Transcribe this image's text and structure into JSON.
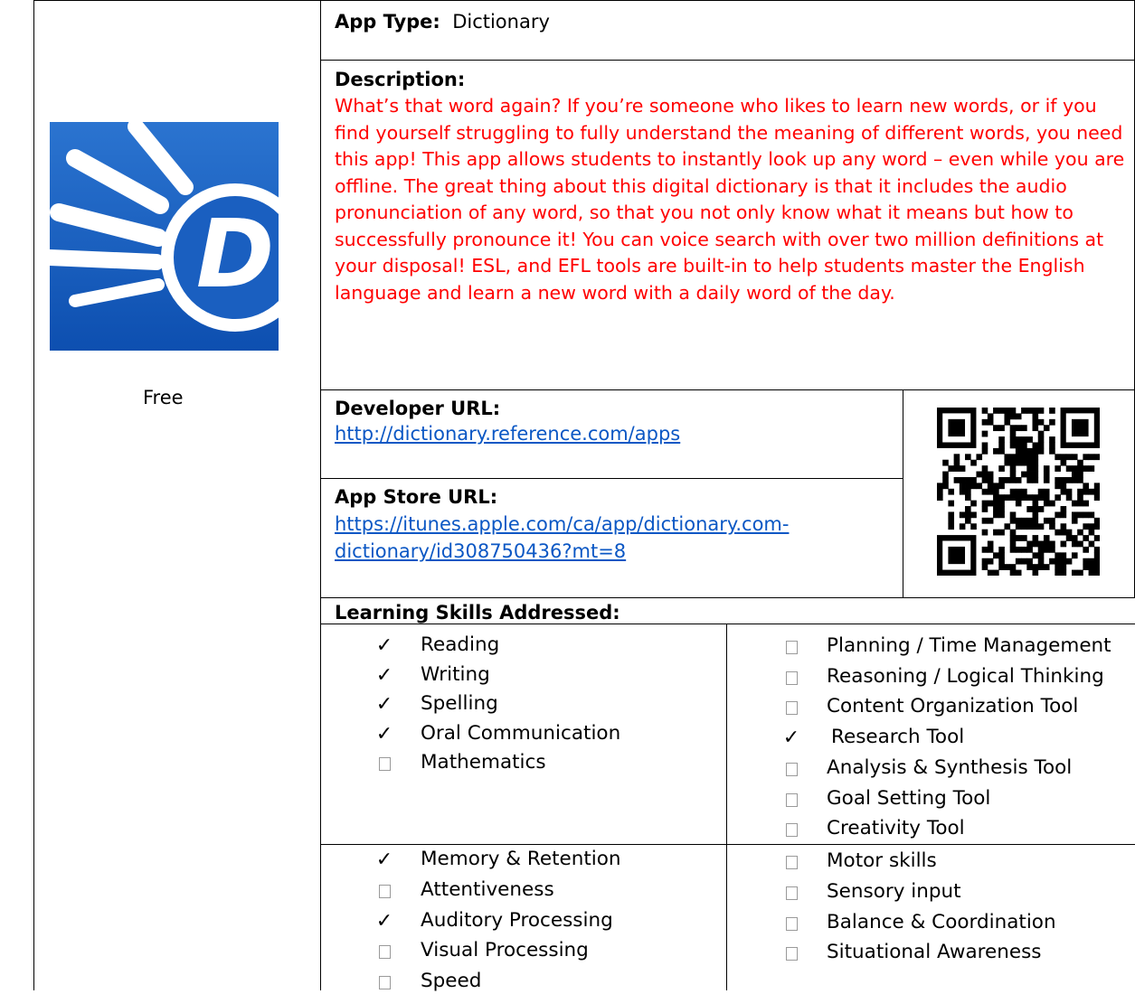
{
  "left": {
    "price": "Free"
  },
  "app_type": {
    "label": "App Type:",
    "value": "Dictionary"
  },
  "description": {
    "label": "Description:",
    "text": "What’s that word again? If you’re someone who likes to learn new words, or if you find yourself struggling to fully understand the meaning of different words, you need this app! This app allows students to instantly look up any word – even while you are offline. The great thing about this digital dictionary is that it includes the audio pronunciation of any word, so that you not only know what it means but how to successfully pronounce it! You can voice search with over two million definitions at your disposal! ESL, and EFL tools are built-in to help students master the English language and learn a new word with a daily word of the day."
  },
  "developer": {
    "label": "Developer URL:",
    "url": "http://dictionary.reference.com/apps"
  },
  "app_store": {
    "label": "App Store URL:",
    "url_line1": "https://itunes.apple.com/ca/app/dictionary.com-",
    "url_line2": "dictionary/id308750436?mt=8"
  },
  "skills": {
    "label": "Learning Skills Addressed:",
    "col1": [
      {
        "label": "Reading",
        "checked": true
      },
      {
        "label": "Writing",
        "checked": true
      },
      {
        "label": "Spelling",
        "checked": true
      },
      {
        "label": "Oral Communication",
        "checked": true
      },
      {
        "label": "Mathematics",
        "checked": false
      }
    ],
    "col2": [
      {
        "label": "Planning / Time Management",
        "checked": false
      },
      {
        "label": "Reasoning / Logical Thinking",
        "checked": false
      },
      {
        "label": "Content Organization Tool",
        "checked": false
      },
      {
        "label": "Research Tool",
        "checked": true
      },
      {
        "label": "Analysis & Synthesis Tool",
        "checked": false
      },
      {
        "label": "Goal Setting Tool",
        "checked": false
      },
      {
        "label": "Creativity Tool",
        "checked": false
      }
    ],
    "col3": [
      {
        "label": "Memory & Retention",
        "checked": true
      },
      {
        "label": "Attentiveness",
        "checked": false
      },
      {
        "label": "Auditory Processing",
        "checked": true
      },
      {
        "label": "Visual Processing",
        "checked": false
      },
      {
        "label": "Speed",
        "checked": false
      }
    ],
    "col4": [
      {
        "label": "Motor skills",
        "checked": false
      },
      {
        "label": "Sensory input",
        "checked": false
      },
      {
        "label": "Balance & Coordination",
        "checked": false
      },
      {
        "label": "Situational Awareness",
        "checked": false
      }
    ]
  },
  "icons": {
    "app_icon": "dictionary-app-icon",
    "app_icon_letter": "D",
    "qr": "qr-code-icon"
  },
  "colors": {
    "description_text": "#ff0000",
    "link": "#0b57c4",
    "icon_blue": "#1a5fc0"
  }
}
